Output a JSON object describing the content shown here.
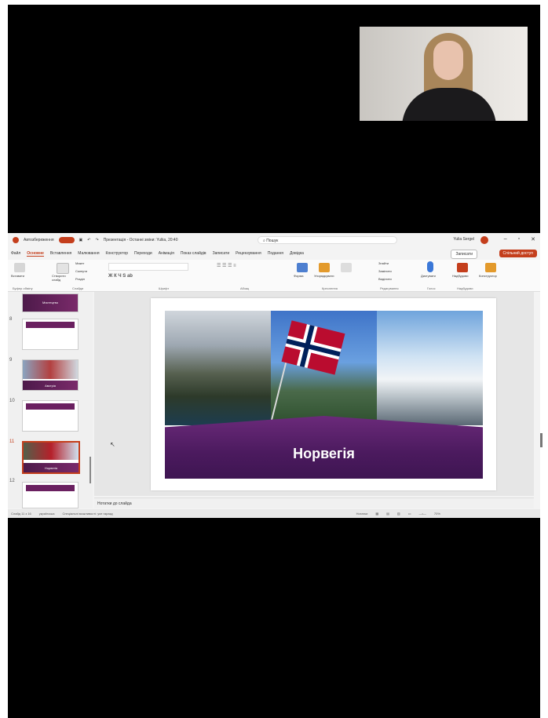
{
  "app": {
    "autosave_label": "Автозбереження",
    "title": "Презентація - Останні зміни: Yuliia, 20:40",
    "search_placeholder": "Пошук",
    "user_name": "Yulia Sergel"
  },
  "menu": {
    "tabs": [
      "Файл",
      "Основне",
      "Вставлення",
      "Малювання",
      "Конструктор",
      "Переходи",
      "Анімація",
      "Показ слайдів",
      "Записати",
      "Рецензування",
      "Подання",
      "Довідка"
    ],
    "active_tab": "Основне",
    "record_label": "Записати",
    "share_label": "Спільний доступ"
  },
  "ribbon": {
    "groups": [
      "Буфер обміну",
      "Слайди",
      "Шрифт",
      "Абзац",
      "Креслення",
      "Редагування",
      "Голос",
      "Надбудови"
    ],
    "buttons": {
      "paste": "Вставити",
      "new_slide": "Створити слайд",
      "layout": "Макет",
      "reset": "Скинути",
      "section": "Розділ",
      "draw": "Форма",
      "arrange": "Упорядкувати",
      "find": "Знайти",
      "replace": "Замінити",
      "select": "Виділити",
      "dictate": "Диктувати",
      "addins": "Надбудови",
      "designer": "Конструктор"
    }
  },
  "slides": {
    "numbers": [
      "8",
      "9",
      "10",
      "11",
      "12"
    ],
    "selected": "11",
    "titles": {
      "s7": "Мистецтво",
      "s9": "Австрія",
      "s11": "Норвегія"
    }
  },
  "slide": {
    "title": "Норвегія"
  },
  "notes": {
    "placeholder": "Нотатки до слайда"
  },
  "status": {
    "slide_counter": "Слайд 11 з 16",
    "language": "українська",
    "accessibility": "Спеціальні можливості: усе гаразд",
    "notes_btn": "Нотатки",
    "zoom": "70%"
  },
  "colors": {
    "accent": "#c43e1c",
    "banner": "#4b1a5e"
  }
}
